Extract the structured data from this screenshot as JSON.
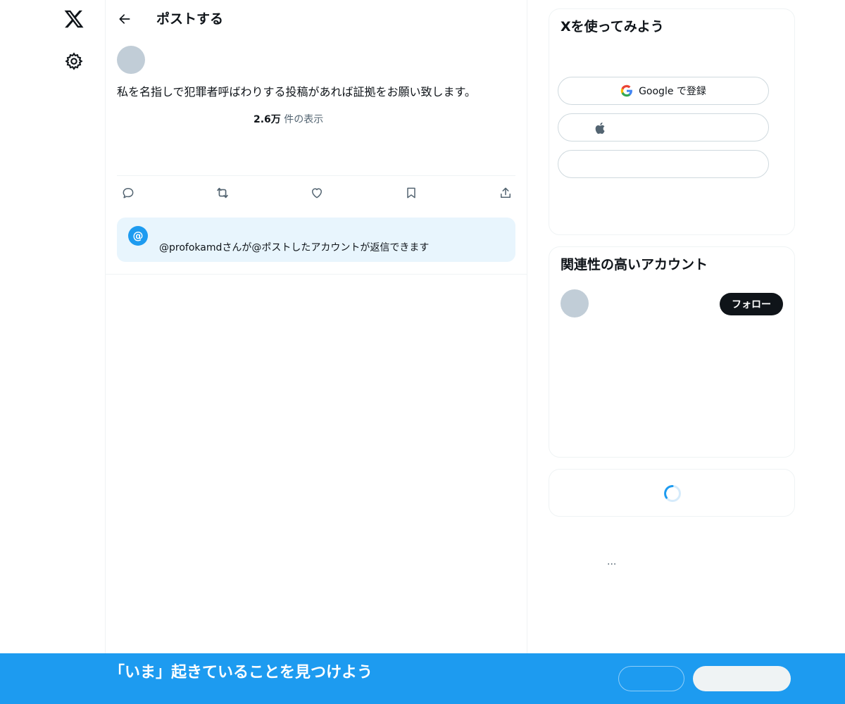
{
  "nav": {
    "logo_icon": "x-logo-icon",
    "settings_icon": "gear-icon"
  },
  "header": {
    "back_icon": "arrow-left-icon",
    "title": "ポストする"
  },
  "post": {
    "text": "私を名指しで犯罪者呼ばわりする投稿があれば証拠をお願い致します。",
    "views_count": "2.6万",
    "views_suffix": " 件の表示"
  },
  "actions": {
    "reply_icon": "reply-icon",
    "repost_icon": "repost-icon",
    "like_icon": "heart-icon",
    "bookmark_icon": "bookmark-icon",
    "share_icon": "share-icon"
  },
  "reply_notice": {
    "at_symbol": "@",
    "text": "@profokamdさんが@ポストしたアカウントが返信できます"
  },
  "signup_card": {
    "title": "Xを使ってみよう",
    "google_label": "Google で登録"
  },
  "related_card": {
    "title": "関連性の高いアカウント",
    "follow_label": "フォロー"
  },
  "misc": {
    "ellipsis": "..."
  },
  "bottom_bar": {
    "text": "「いま」起きていることを見つけよう"
  },
  "colors": {
    "brand_blue": "#1d9bf0",
    "reply_bg": "#e8f5fd",
    "text_primary": "#0f1419",
    "text_secondary": "#536471"
  }
}
